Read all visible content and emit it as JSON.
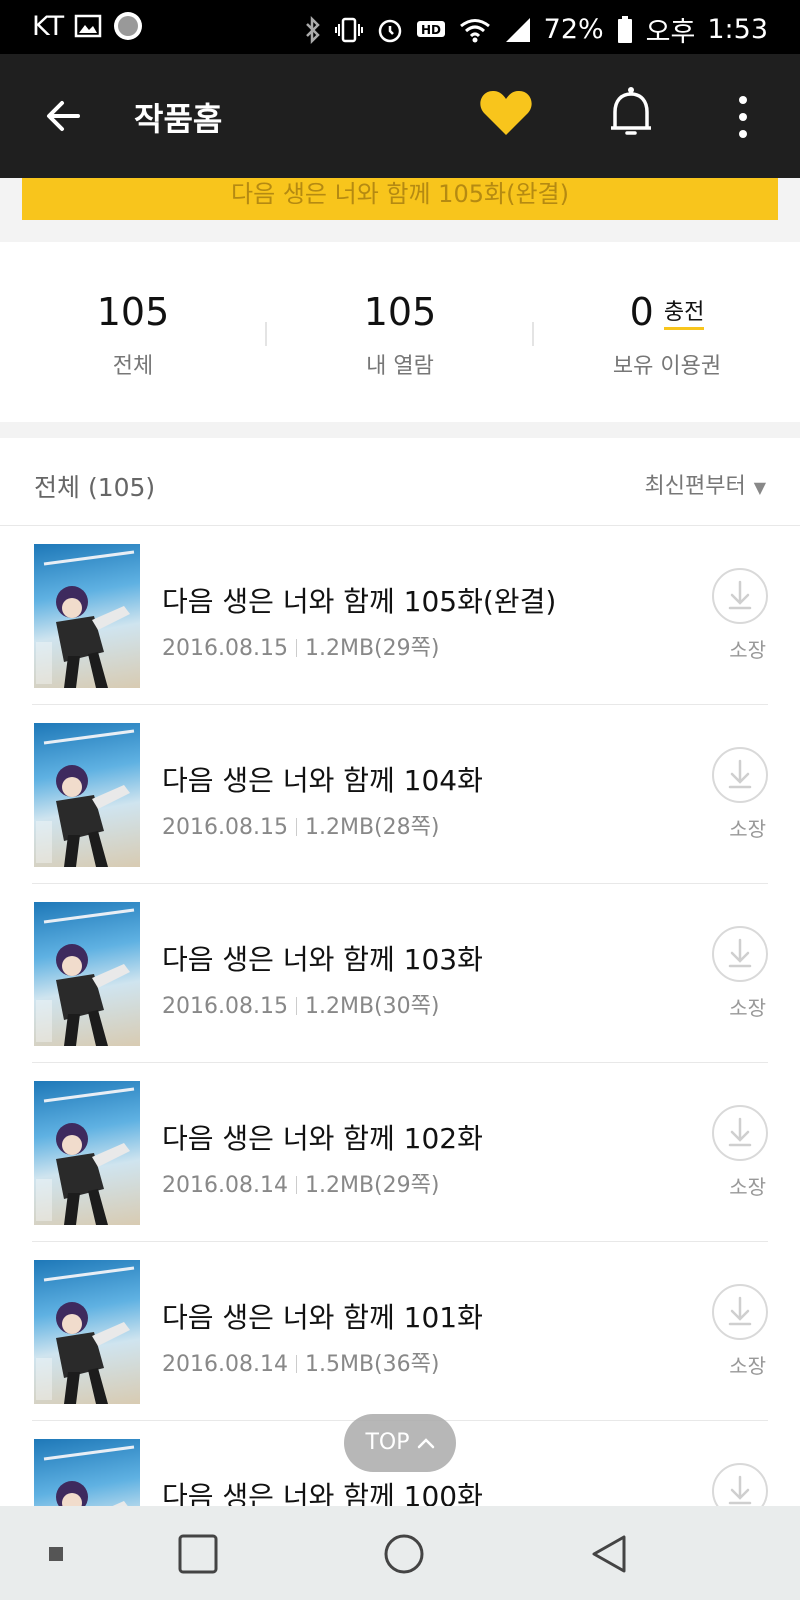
{
  "status_bar": {
    "carrier": "KT",
    "battery": "72%",
    "time_period": "오후",
    "time": "1:53"
  },
  "app_bar": {
    "title": "작품홈"
  },
  "banner": {
    "text": "다음 생은 너와 함께 105화(완결)"
  },
  "stats": {
    "total": {
      "value": "105",
      "label": "전체"
    },
    "read": {
      "value": "105",
      "label": "내 열람"
    },
    "tickets": {
      "value": "0",
      "label": "보유 이용권",
      "action": "충전"
    }
  },
  "list_header": {
    "count_label": "전체 (105)",
    "sort_label": "최신편부터"
  },
  "episodes": [
    {
      "title": "다음 생은 너와 함께 105화(완결)",
      "date": "2016.08.15",
      "size": "1.2MB(29쪽)",
      "action": "소장"
    },
    {
      "title": "다음 생은 너와 함께 104화",
      "date": "2016.08.15",
      "size": "1.2MB(28쪽)",
      "action": "소장"
    },
    {
      "title": "다음 생은 너와 함께 103화",
      "date": "2016.08.15",
      "size": "1.2MB(30쪽)",
      "action": "소장"
    },
    {
      "title": "다음 생은 너와 함께 102화",
      "date": "2016.08.14",
      "size": "1.2MB(29쪽)",
      "action": "소장"
    },
    {
      "title": "다음 생은 너와 함께 101화",
      "date": "2016.08.14",
      "size": "1.5MB(36쪽)",
      "action": "소장"
    },
    {
      "title": "다음 생은 너와 함께 100화",
      "date": "",
      "size": "",
      "action": ""
    }
  ],
  "top_button": {
    "label": "TOP"
  },
  "colors": {
    "accent": "#f8c51c",
    "app_bar": "#1f1f1f"
  }
}
